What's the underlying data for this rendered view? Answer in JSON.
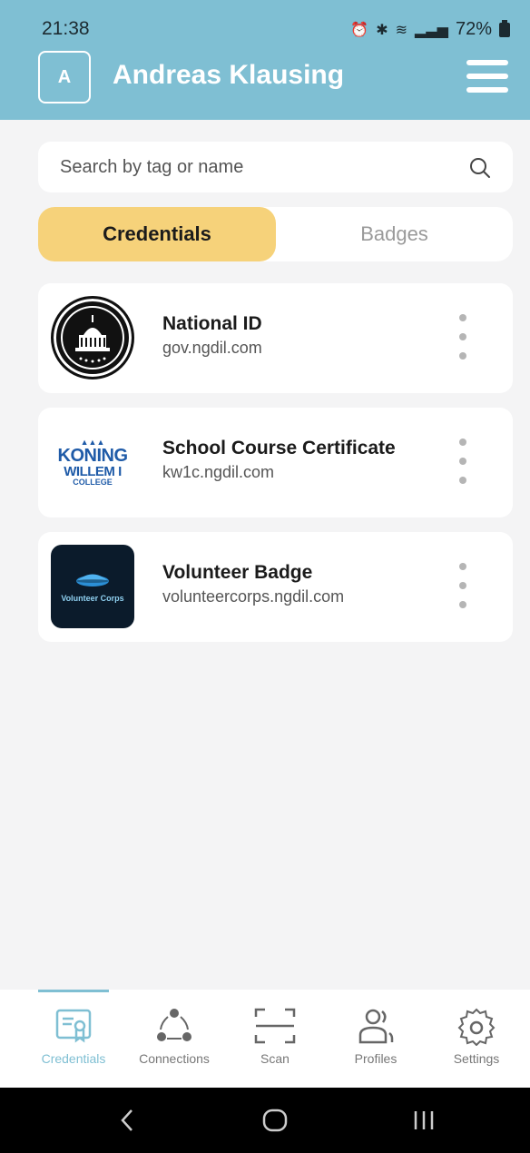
{
  "status": {
    "time": "21:38",
    "battery": "72%"
  },
  "header": {
    "avatar_initial": "A",
    "user_name": "Andreas Klausing"
  },
  "search": {
    "placeholder": "Search by tag or name"
  },
  "tabs": [
    {
      "label": "Credentials",
      "active": true
    },
    {
      "label": "Badges",
      "active": false
    }
  ],
  "credentials": [
    {
      "title": "National ID",
      "domain": "gov.ngdil.com",
      "logo": "seal-logo"
    },
    {
      "title": "School Course Certificate",
      "domain": "kw1c.ngdil.com",
      "logo": "koning-willem-logo"
    },
    {
      "title": "Volunteer Badge",
      "domain": "volunteercorps.ngdil.com",
      "logo": "volunteer-corps-logo"
    }
  ],
  "logos": {
    "koning_line1": "KONING",
    "koning_line2": "WILLEM I",
    "koning_line3": "COLLEGE",
    "volunteer_text": "Volunteer Corps"
  },
  "bottom_nav": [
    {
      "label": "Credentials",
      "icon": "certificate-icon",
      "active": true
    },
    {
      "label": "Connections",
      "icon": "connections-icon",
      "active": false
    },
    {
      "label": "Scan",
      "icon": "scan-icon",
      "active": false
    },
    {
      "label": "Profiles",
      "icon": "profiles-icon",
      "active": false
    },
    {
      "label": "Settings",
      "icon": "gear-icon",
      "active": false
    }
  ],
  "colors": {
    "header": "#7fbfd3",
    "tab_active": "#f6d27a",
    "nav_active": "#7fbfd3"
  }
}
